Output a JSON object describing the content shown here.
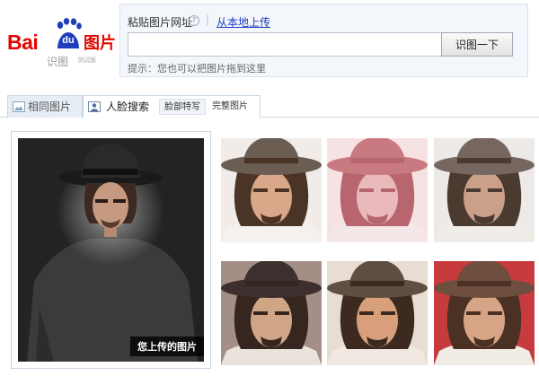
{
  "logo": {
    "bai": "Bai",
    "du": "du",
    "pic": "图片",
    "sub": "识图",
    "beta": "测试版",
    "brand_red": "#e10601",
    "brand_blue": "#1f3ebb"
  },
  "search": {
    "paste_label": "粘贴图片网址",
    "help_icon": "?",
    "separator": "|",
    "upload_link": "从本地上传",
    "url_value": "",
    "button": "识图一下",
    "hint": "提示：您也可以把图片拖到这里"
  },
  "tabs": {
    "same": "相同图片",
    "face": "人脸搜索",
    "sub_close": "脸部特写",
    "sub_full": "完整图片"
  },
  "uploaded": {
    "caption": "您上传的图片"
  },
  "results": [
    {
      "tone": "normal",
      "hat": "#6b5d52",
      "skin": "#d9a889",
      "hair": "#4a3426",
      "bg": "#f1ece7",
      "shirt": "#f4f1ee"
    },
    {
      "tone": "pink",
      "hat": "#c97a80",
      "skin": "#e9b9bb",
      "hair": "#b7666f",
      "bg": "#f7e2e3",
      "shirt": "#f5e6e7"
    },
    {
      "tone": "muted",
      "hat": "#756760",
      "skin": "#caa088",
      "hair": "#4b3a2f",
      "bg": "#ede9e6",
      "shirt": "#f0ece8"
    },
    {
      "tone": "dark",
      "hat": "#3c2f2d",
      "skin": "#cfa585",
      "hair": "#352620",
      "bg": "#a48f86",
      "shirt": "#eae3dc"
    },
    {
      "tone": "warm",
      "hat": "#5f4e42",
      "skin": "#d8a07a",
      "hair": "#3c2a20",
      "bg": "#e8ddd2",
      "shirt": "#f1e9e1"
    },
    {
      "tone": "red",
      "hat": "#6e4e3e",
      "skin": "#d7a586",
      "hair": "#4a3124",
      "bg": "#c73b3e",
      "shirt": "#f2ece6"
    }
  ]
}
